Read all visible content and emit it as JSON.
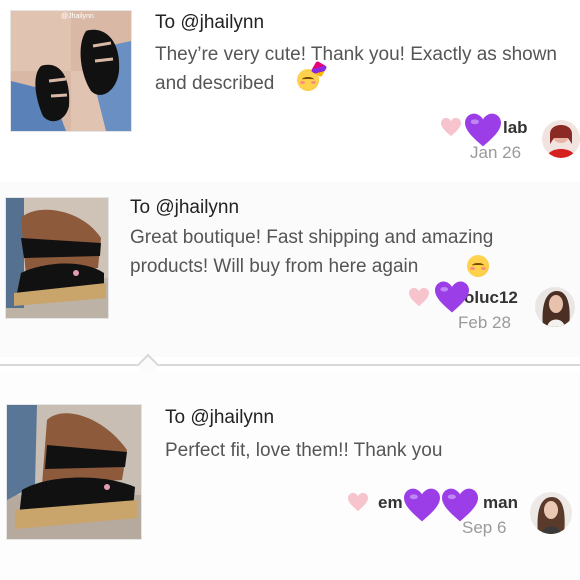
{
  "reviews": [
    {
      "to": "To @jhailynn",
      "message": "They’re very cute! Thank you! Exactly as shown and described",
      "emoji": "partying-face",
      "username_fragment": "lab",
      "date_fragment": "Jan 26",
      "thumb_watermark": "@Jhailynn"
    },
    {
      "to": "To @jhailynn",
      "message": "Great boutique! Fast shipping and amazing products! Will buy from here again",
      "emoji": "smiling-face",
      "username_fragment": "oluc12",
      "date_fragment": "Feb 28"
    },
    {
      "to": "To @jhailynn",
      "message": "Perfect fit, love them!! Thank you",
      "username_fragment_left": "em",
      "username_fragment_right": "man",
      "date_fragment": "Sep 6"
    }
  ],
  "colors": {
    "purple_heart": "#9b3ee8",
    "pale_heart": "#f7c3cc"
  }
}
